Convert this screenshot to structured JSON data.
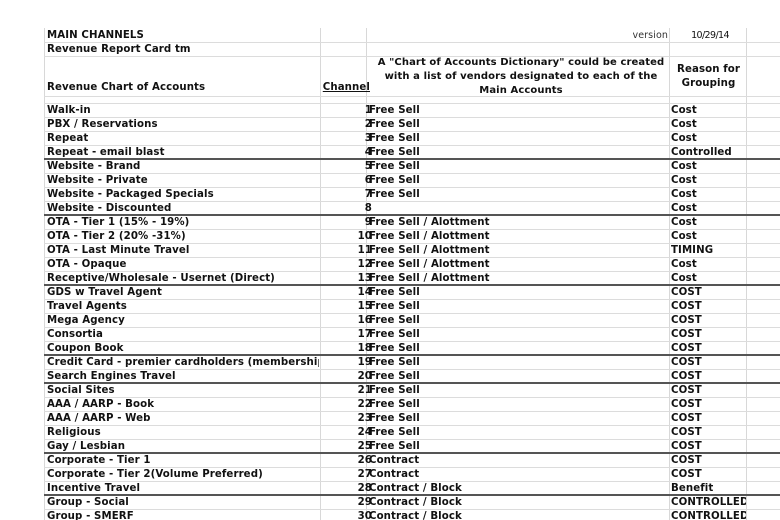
{
  "header": {
    "title": "MAIN CHANNELS",
    "subtitle": "Revenue Report Card tm",
    "version_label": "version",
    "version_date": "10/29/14",
    "col_account": "Revenue Chart of Accounts",
    "col_channel": "Channel",
    "col_note": "A \"Chart of Accounts Dictionary\" could be created with a list of vendors designated to each of the Main Accounts",
    "col_reason": "Reason for Grouping"
  },
  "rows": [
    {
      "account": "Walk-in",
      "channel": "1",
      "type": "Free Sell",
      "reason": "Cost"
    },
    {
      "account": "PBX / Reservations",
      "channel": "2",
      "type": "Free Sell",
      "reason": "Cost"
    },
    {
      "account": "Repeat",
      "channel": "3",
      "type": "Free Sell",
      "reason": "Cost"
    },
    {
      "account": "Repeat - email blast",
      "channel": "4",
      "type": "Free Sell",
      "reason": "Controlled"
    },
    {
      "account": "Website - Brand",
      "channel": "5",
      "type": "Free Sell",
      "reason": "Cost"
    },
    {
      "account": "Website - Private",
      "channel": "6",
      "type": "Free Sell",
      "reason": "Cost"
    },
    {
      "account": "Website - Packaged Specials",
      "channel": "7",
      "type": "Free Sell",
      "reason": "Cost"
    },
    {
      "account": "Website - Discounted",
      "channel": "8",
      "type": "",
      "reason": "Cost"
    },
    {
      "account": "OTA - Tier 1 (15% - 19%)",
      "channel": "9",
      "type": "Free Sell / Alottment",
      "reason": "Cost"
    },
    {
      "account": "OTA - Tier 2 (20% -31%)",
      "channel": "10",
      "type": "Free Sell / Alottment",
      "reason": "Cost"
    },
    {
      "account": "OTA - Last Minute Travel",
      "channel": "11",
      "type": "Free Sell / Alottment",
      "reason": "TIMING"
    },
    {
      "account": "OTA - Opaque",
      "channel": "12",
      "type": "Free Sell / Alottment",
      "reason": "Cost"
    },
    {
      "account": "Receptive/Wholesale - Usernet (Direct)",
      "channel": "13",
      "type": "Free Sell / Alottment",
      "reason": "Cost"
    },
    {
      "account": "GDS w Travel Agent",
      "channel": "14",
      "type": "Free Sell",
      "reason": "COST"
    },
    {
      "account": "Travel Agents",
      "channel": "15",
      "type": "Free Sell",
      "reason": "COST"
    },
    {
      "account": "Mega Agency",
      "channel": "16",
      "type": "Free Sell",
      "reason": "COST"
    },
    {
      "account": "Consortia",
      "channel": "17",
      "type": "Free Sell",
      "reason": "COST"
    },
    {
      "account": "Coupon Book",
      "channel": "18",
      "type": "Free Sell",
      "reason": "COST"
    },
    {
      "account": "Credit Card - premier cardholders (membership)",
      "channel": "19",
      "type": "Free Sell",
      "reason": "COST"
    },
    {
      "account": "Search Engines Travel",
      "channel": "20",
      "type": "Free Sell",
      "reason": "COST"
    },
    {
      "account": "Social Sites",
      "channel": "21",
      "type": "Free Sell",
      "reason": "COST"
    },
    {
      "account": "AAA / AARP - Book",
      "channel": "22",
      "type": "Free Sell",
      "reason": "COST"
    },
    {
      "account": "AAA / AARP - Web",
      "channel": "23",
      "type": "Free Sell",
      "reason": "COST"
    },
    {
      "account": "Religious",
      "channel": "24",
      "type": "Free Sell",
      "reason": "COST"
    },
    {
      "account": "Gay / Lesbian",
      "channel": "25",
      "type": "Free Sell",
      "reason": "COST"
    },
    {
      "account": "Corporate - Tier 1",
      "channel": "26",
      "type": "Contract",
      "reason": "COST"
    },
    {
      "account": "Corporate - Tier 2(Volume Preferred)",
      "channel": "27",
      "type": "Contract",
      "reason": "COST"
    },
    {
      "account": "Incentive Travel",
      "channel": "28",
      "type": "Contract / Block",
      "reason": "Benefit"
    },
    {
      "account": "Group - Social",
      "channel": "29",
      "type": "Contract / Block",
      "reason": "CONTROLLED"
    },
    {
      "account": "Group - SMERF",
      "channel": "30",
      "type": "Contract / Block",
      "reason": "CONTROLLED"
    }
  ]
}
